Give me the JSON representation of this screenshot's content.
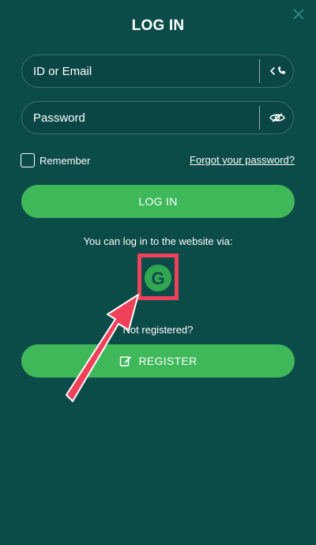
{
  "header": {
    "title": "LOG IN",
    "close_icon": "close-icon"
  },
  "form": {
    "id_placeholder": "ID or Email",
    "id_icons": [
      "chevron-left-icon",
      "phone-icon"
    ],
    "password_placeholder": "Password",
    "password_icon": "eye-slash-icon",
    "remember_label": "Remember",
    "remember_checked": false,
    "forgot_label": "Forgot your password?",
    "login_button_label": "LOG IN"
  },
  "social": {
    "via_text": "You can log in to the website via:",
    "providers": [
      {
        "name": "google",
        "letter": "G",
        "icon": "google-icon"
      }
    ]
  },
  "register": {
    "prompt": "Not registered?",
    "button_label": "REGISTER",
    "button_icon": "edit-icon"
  },
  "colors": {
    "background": "#0b4b48",
    "accent_green": "#3fb85a",
    "highlight_red": "#f0415a"
  }
}
